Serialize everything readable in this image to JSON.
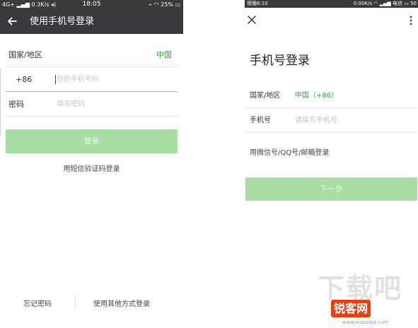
{
  "left_screen": {
    "status_bar": {
      "network": "4G+",
      "speed": "0.3K/s",
      "time": "18:05",
      "battery": "25%"
    },
    "header": {
      "title": "使用手机号登录"
    },
    "country": {
      "label": "国家/地区",
      "value": "中国"
    },
    "phone": {
      "code": "+86",
      "placeholder": "你的手机号码"
    },
    "password": {
      "label": "密码",
      "placeholder": "填写密码"
    },
    "login_button": "登录",
    "sms_login": "用短信验证码登录",
    "forgot_password": "忘记密码",
    "other_methods": "使用其他方式登录"
  },
  "right_screen": {
    "status_bar": {
      "time": "傍晚6:10",
      "speed": "0.00K/s",
      "carrier": "电信",
      "battery": "50"
    },
    "title": "手机号登录",
    "country": {
      "label": "国家/地区",
      "value": "中国（+86）"
    },
    "phone": {
      "label": "手机号",
      "placeholder": "请填写手机号"
    },
    "alt_login": "用微信号/QQ号/邮箱登录",
    "next_button": "下一步"
  },
  "watermark": {
    "main": "下载吧",
    "badge": "锐客网",
    "url": "www.xiazaiba.com"
  },
  "colors": {
    "accent": "#2fa53d",
    "button_disabled": "#a8dea4",
    "topbar": "#393a3e",
    "watermark_badge": "#e64010"
  }
}
